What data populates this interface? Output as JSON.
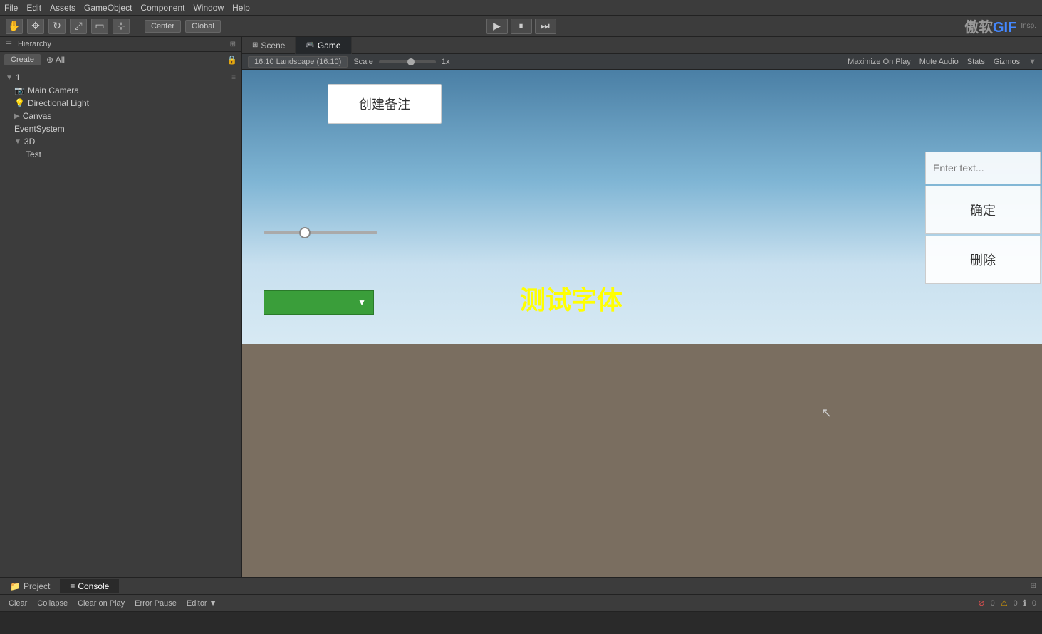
{
  "menubar": {
    "items": [
      "File",
      "Edit",
      "Assets",
      "GameObject",
      "Component",
      "Window",
      "Help"
    ]
  },
  "toolbar": {
    "transform_tools": [
      "hand",
      "move",
      "rotate",
      "scale",
      "rect",
      "universal"
    ],
    "center_label": "Center",
    "global_label": "Global",
    "play_btn": "▶",
    "pause_btn": "⏸",
    "step_btn": "⏭"
  },
  "hierarchy": {
    "title": "Hierarchy",
    "create_label": "Create",
    "all_label": "All",
    "items": [
      {
        "label": "1",
        "level": 0,
        "collapsed": false,
        "id": "root1",
        "hasArrow": true
      },
      {
        "label": "Main Camera",
        "level": 1,
        "id": "mainCamera"
      },
      {
        "label": "Directional Light",
        "level": 1,
        "id": "dirLight"
      },
      {
        "label": "Canvas",
        "level": 1,
        "id": "canvas",
        "hasArrow": true,
        "collapsed": false
      },
      {
        "label": "EventSystem",
        "level": 1,
        "id": "eventSystem"
      },
      {
        "label": "3D",
        "level": 1,
        "id": "3d",
        "hasArrow": true,
        "collapsed": false
      },
      {
        "label": "Test",
        "level": 2,
        "id": "test"
      }
    ]
  },
  "scene_tabs": [
    {
      "label": "Scene",
      "icon": "⊞",
      "active": false
    },
    {
      "label": "Game",
      "icon": "🎮",
      "active": true
    }
  ],
  "viewport_toolbar": {
    "aspect_label": "16:10 Landscape (16:10)",
    "scale_label": "Scale",
    "scale_value": "1x",
    "maximize_label": "Maximize On Play",
    "mute_label": "Mute Audio",
    "stats_label": "Stats",
    "gizmos_label": "Gizmos"
  },
  "game_ui": {
    "create_btn": "创建备注",
    "text_label": "测试字体",
    "slider_value": 35,
    "input_placeholder": "Enter text...",
    "confirm_btn": "确定",
    "delete_btn": "删除"
  },
  "bottom": {
    "tabs": [
      {
        "label": "Project",
        "icon": "📁",
        "active": false
      },
      {
        "label": "Console",
        "icon": "≡",
        "active": true
      }
    ],
    "toolbar": {
      "clear_label": "Clear",
      "collapse_label": "Collapse",
      "clear_on_play_label": "Clear on Play",
      "error_pause_label": "Error Pause",
      "editor_label": "Editor ▼"
    },
    "right": {
      "errors": "0",
      "warnings": "0",
      "messages": "0"
    }
  },
  "watermark": {
    "text1": "傲软",
    "text2": "GIF"
  }
}
